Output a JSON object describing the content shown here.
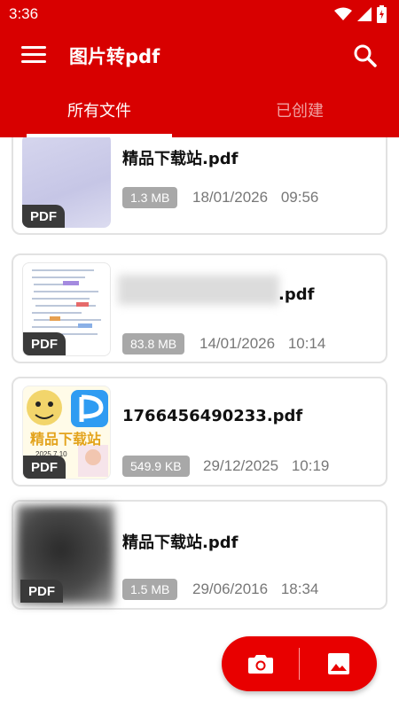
{
  "status_bar": {
    "time": "3:36",
    "icons": [
      "wifi-icon",
      "signal-icon",
      "battery-icon"
    ]
  },
  "app_bar": {
    "title": "图片转pdf",
    "menu_icon": "menu-icon",
    "search_icon": "search-icon"
  },
  "tabs": [
    {
      "label": "所有文件",
      "active": true
    },
    {
      "label": "已创建",
      "active": false
    }
  ],
  "files": [
    {
      "name": "精品下载站.pdf",
      "size": "1.3 MB",
      "date": "18/01/2026",
      "time": "09:56",
      "badge": "PDF"
    },
    {
      "name": ".pdf",
      "size": "83.8 MB",
      "date": "14/01/2026",
      "time": "10:14",
      "badge": "PDF"
    },
    {
      "name": "1766456490233.pdf",
      "size": "549.9 KB",
      "date": "29/12/2025",
      "time": "10:19",
      "badge": "PDF"
    },
    {
      "name": "精品下载站.pdf",
      "size": "1.5 MB",
      "date": "29/06/2016",
      "time": "18:34",
      "badge": "PDF"
    }
  ],
  "thumb3": {
    "caption": "精品下载站",
    "date_text": "2025.7.10"
  },
  "fab": {
    "left_icon": "camera-icon",
    "right_icon": "image-icon"
  },
  "colors": {
    "primary": "#d80000",
    "fab": "#e80000",
    "badge_dark": "#3a3a3a",
    "size_badge": "#a8a8a8"
  }
}
